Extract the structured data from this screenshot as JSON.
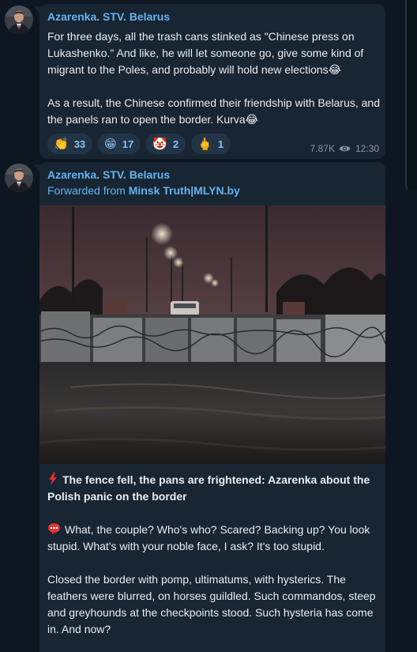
{
  "messages": [
    {
      "author": "Azarenka. STV. Belarus",
      "paragraphs": [
        "For three days, all the trash cans stinked as \"Chinese press on Lukashenko.\" And like, he will let someone go, give some kind of migrant to the Poles, and probably will hold new elections😂",
        "As a result, the Chinese confirmed their friendship with Belarus, and the panels ran to open the border. Kurva😂"
      ],
      "reactions": [
        {
          "emoji": "👏",
          "count": "33"
        },
        {
          "emoji": "😁",
          "count": "17"
        },
        {
          "emoji": "🤡",
          "count": "2"
        },
        {
          "emoji": "🖕",
          "count": "1"
        }
      ],
      "views": "7.87K",
      "time": "12:30"
    },
    {
      "author": "Azarenka. STV. Belarus",
      "forwarded_prefix": "Forwarded from ",
      "forwarded_source": "Minsk Truth|MLYN.by",
      "title_icon": "lightning-icon",
      "title": "The fence fell, the pans are frightened: Azarenka about the Polish panic on the border",
      "paragraph_icon": "speech-bubble-icon",
      "paragraphs": [
        "What, the couple? Who's who? Scared? Backing up? You look stupid. What's with your noble face, I ask? It's too stupid.",
        "Closed the border with pomp, ultimatums, with hysterics. The feathers were blurred, on horses guildled. Such commandos, steep and greyhounds at the checkpoints stood. Such hysteria has come in. And now?"
      ]
    }
  ],
  "colors": {
    "background": "#0e1621",
    "bubble": "#182533",
    "author": "#64b5ef",
    "reaction_bg": "#243447",
    "reaction_text": "#8ec2ee",
    "meta": "#8a98a8"
  }
}
